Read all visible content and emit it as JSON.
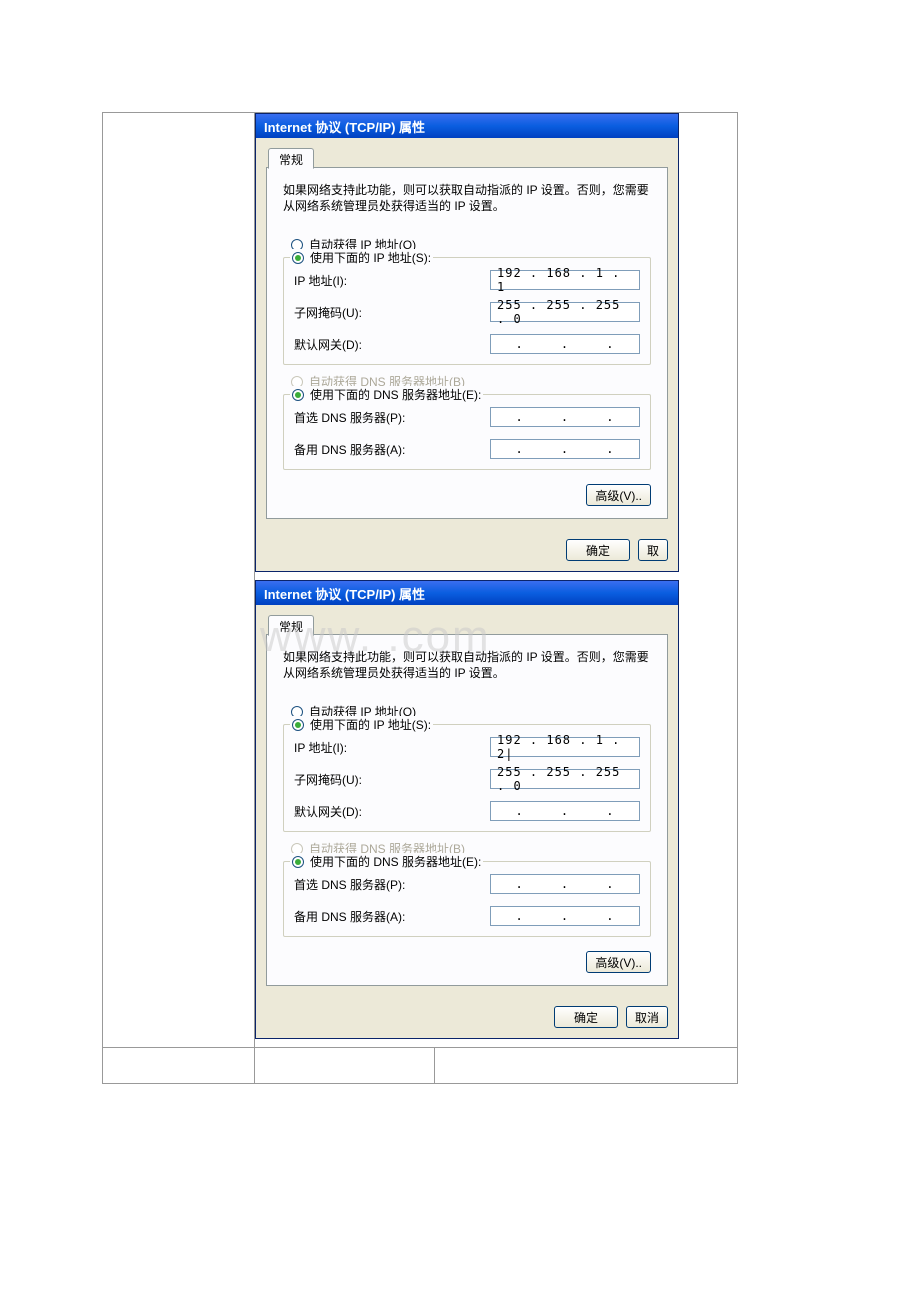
{
  "watermark": "www.        .com",
  "dialogs": [
    {
      "title": "Internet 协议 (TCP/IP) 属性",
      "tab": "常规",
      "intro": "如果网络支持此功能，则可以获取自动指派的 IP 设置。否则，您需要从网络系统管理员处获得适当的 IP 设置。",
      "ip_auto": "自动获得 IP 地址(O)",
      "ip_manual": "使用下面的 IP 地址(S):",
      "ip_label": "IP 地址(I):",
      "ip_value": "192 . 168 .  1  .  1",
      "mask_label": "子网掩码(U):",
      "mask_value": "255 . 255 . 255 .  0",
      "gw_label": "默认网关(D):",
      "dns_auto": "自动获得 DNS 服务器地址(B)",
      "dns_manual": "使用下面的 DNS 服务器地址(E):",
      "dns1_label": "首选 DNS 服务器(P):",
      "dns2_label": "备用 DNS 服务器(A):",
      "advanced": "高级(V)..",
      "ok": "确定",
      "cancel": "取"
    },
    {
      "title": "Internet 协议 (TCP/IP) 属性",
      "tab": "常规",
      "intro": "如果网络支持此功能，则可以获取自动指派的 IP 设置。否则，您需要从网络系统管理员处获得适当的 IP 设置。",
      "ip_auto": "自动获得 IP 地址(O)",
      "ip_manual": "使用下面的 IP 地址(S):",
      "ip_label": "IP 地址(I):",
      "ip_value": "192 . 168 .  1  .  2|",
      "mask_label": "子网掩码(U):",
      "mask_value": "255 . 255 . 255 .  0",
      "gw_label": "默认网关(D):",
      "dns_auto": "自动获得 DNS 服务器地址(B)",
      "dns_manual": "使用下面的 DNS 服务器地址(E):",
      "dns1_label": "首选 DNS 服务器(P):",
      "dns2_label": "备用 DNS 服务器(A):",
      "advanced": "高级(V)..",
      "ok": "确定",
      "cancel": "取消"
    }
  ]
}
